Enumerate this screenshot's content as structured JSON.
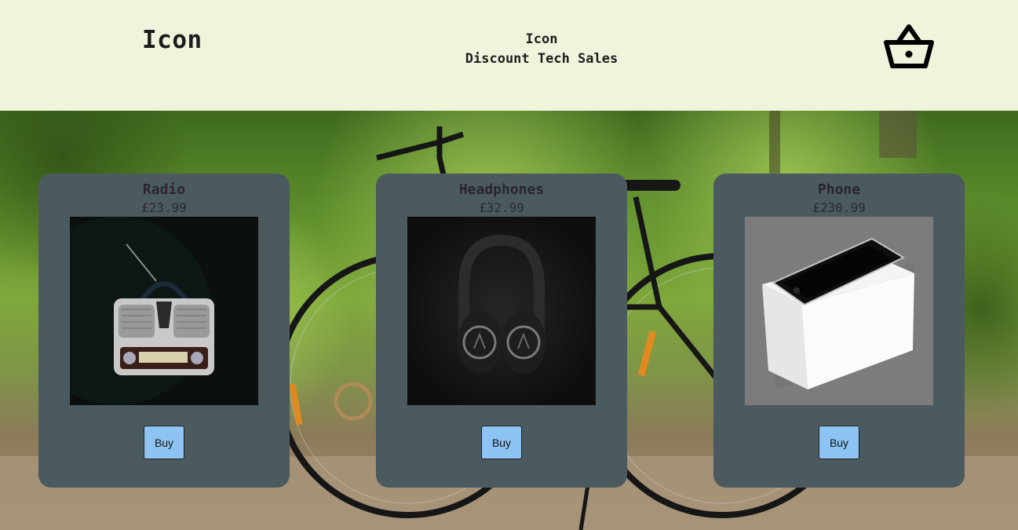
{
  "header": {
    "brand": "Icon",
    "tagline_line1": "Icon",
    "tagline_line2": "Discount Tech Sales",
    "cart_icon": "basket-icon"
  },
  "products": [
    {
      "name": "Radio",
      "price": "£23.99",
      "buy_label": "Buy",
      "image": "vintage-radio-photo"
    },
    {
      "name": "Headphones",
      "price": "£32.99",
      "buy_label": "Buy",
      "image": "headphones-photo"
    },
    {
      "name": "Phone",
      "price": "£230.99",
      "buy_label": "Buy",
      "image": "smartphone-on-box-photo"
    }
  ],
  "colors": {
    "header_bg": "#eff5dc",
    "card_bg": "#4b5a5f",
    "button_bg": "#8ec4f3",
    "text_dark": "#1d1d1d"
  }
}
